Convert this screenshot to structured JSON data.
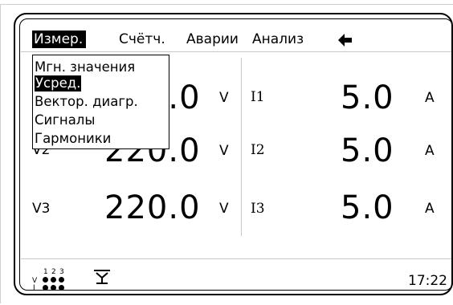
{
  "menu": {
    "tabs": [
      {
        "label": "Измер.",
        "active": true
      },
      {
        "label": "Счётч.",
        "active": false
      },
      {
        "label": "Аварии",
        "active": false
      },
      {
        "label": "Анализ",
        "active": false
      }
    ],
    "back_icon": "left-arrow-icon"
  },
  "dropdown": {
    "items": [
      {
        "label": "Мгн. значения",
        "selected": false
      },
      {
        "label": "Усред.",
        "selected": true
      },
      {
        "label": "Вектор. диагр.",
        "selected": false
      },
      {
        "label": "Сигналы",
        "selected": false
      },
      {
        "label": "Гармоники",
        "selected": false
      }
    ]
  },
  "voltage": {
    "rows": [
      {
        "label": "",
        "value": "220.0",
        "unit": "V"
      },
      {
        "label": "V2",
        "value": "220.0",
        "unit": "V"
      },
      {
        "label": "V3",
        "value": "220.0",
        "unit": "V"
      }
    ]
  },
  "current": {
    "rows": [
      {
        "label": "I1",
        "value": "5.0",
        "unit": "A"
      },
      {
        "label": "I2",
        "value": "5.0",
        "unit": "A"
      },
      {
        "label": "I3",
        "value": "5.0",
        "unit": "A"
      }
    ]
  },
  "status": {
    "phase_v_label": "V",
    "phase_i_label": "I",
    "phase_numbers": [
      "1",
      "2",
      "3"
    ],
    "device_icon": "plug-icon",
    "time": "17:22"
  },
  "colors": {
    "foreground": "#000000",
    "background": "#ffffff",
    "separator": "#c8c8c8"
  }
}
